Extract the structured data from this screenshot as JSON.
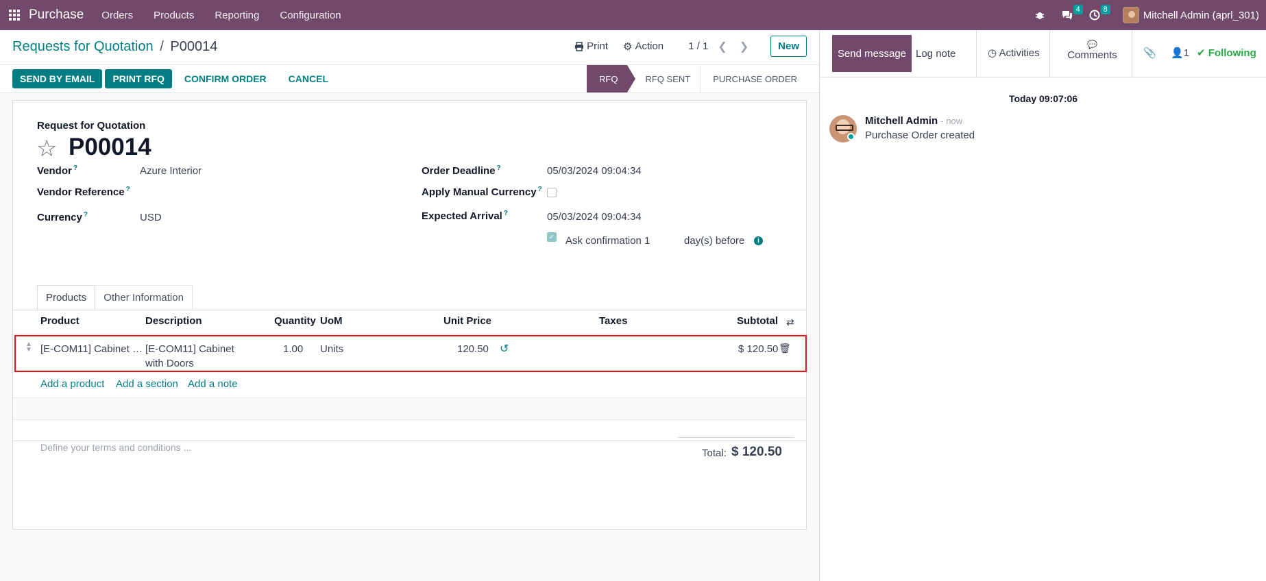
{
  "navbar": {
    "brand": "Purchase",
    "menus": [
      "Orders",
      "Products",
      "Reporting",
      "Configuration"
    ],
    "messages_count": "4",
    "activities_count": "8",
    "user": "Mitchell Admin (aprl_301)"
  },
  "control": {
    "breadcrumb_parent": "Requests for Quotation",
    "breadcrumb_sep": "/",
    "breadcrumb_current": "P00014",
    "print": "Print",
    "action": "Action",
    "pager": "1 / 1",
    "new": "New"
  },
  "statusbar": {
    "send_by_email": "SEND BY EMAIL",
    "print_rfq": "PRINT RFQ",
    "confirm_order": "CONFIRM ORDER",
    "cancel": "CANCEL",
    "stages": [
      "RFQ",
      "RFQ SENT",
      "PURCHASE ORDER"
    ],
    "active_stage": "RFQ"
  },
  "form": {
    "doc_type": "Request for Quotation",
    "name": "P00014",
    "vendor_label": "Vendor",
    "vendor": "Azure Interior",
    "vendor_ref_label": "Vendor Reference",
    "vendor_ref": "",
    "currency_label": "Currency",
    "currency": "USD",
    "order_deadline_label": "Order Deadline",
    "order_deadline": "05/03/2024 09:04:34",
    "manual_currency_label": "Apply Manual Currency",
    "manual_currency_checked": false,
    "expected_arrival_label": "Expected Arrival",
    "expected_arrival": "05/03/2024 09:04:34",
    "ask_confirmation_label": "Ask confirmation",
    "ask_confirmation_checked": true,
    "ask_confirmation_days": "1",
    "days_before": "day(s) before",
    "help_mark": "?"
  },
  "tabs": [
    "Products",
    "Other Information"
  ],
  "lines": {
    "headers": [
      "Product",
      "Description",
      "Quantity",
      "UoM",
      "Unit Price",
      "Taxes",
      "Subtotal"
    ],
    "rows": [
      {
        "product": "[E-COM11] Cabinet …",
        "description_1": "[E-COM11] Cabinet",
        "description_2": "with Doors",
        "quantity": "1.00",
        "uom": "Units",
        "unit_price": "120.50",
        "taxes": "",
        "subtotal": "$ 120.50"
      }
    ],
    "add_product": "Add a product",
    "add_section": "Add a section",
    "add_note": "Add a note"
  },
  "footer": {
    "terms_placeholder": "Define your terms and conditions ...",
    "total_label": "Total:",
    "total": "$ 120.50"
  },
  "chatter": {
    "send_message": "Send message",
    "log_note": "Log note",
    "activities": "Activities",
    "comments": "Comments",
    "followers_count": "1",
    "following": "Following",
    "date": "Today 09:07:06",
    "messages": [
      {
        "author": "Mitchell Admin",
        "time": "- now",
        "body": "Purchase Order created"
      }
    ]
  },
  "colors": {
    "brand": "#71496a",
    "accent": "#017e84",
    "highlight_border": "#e3121b"
  }
}
